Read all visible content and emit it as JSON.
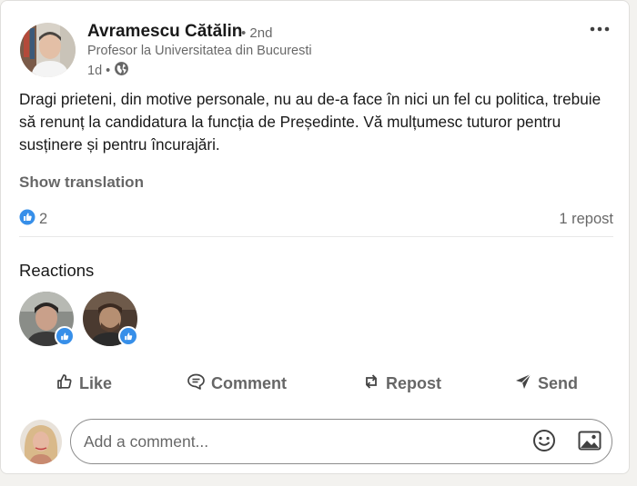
{
  "post": {
    "author": {
      "name": "Avramescu Cătălin",
      "degree": "• 2nd",
      "headline": "Profesor la Universitatea din Bucuresti",
      "time": "1d •",
      "visibility_icon": "globe-icon"
    },
    "more_icon": "more-horizontal-icon",
    "text": "Dragi prieteni, din motive personale, nu au de-a face în nici un fel cu politica, trebuie să renunț la candidatura la funcția de Președinte. Vă mulțumesc tuturor pentru susținere și pentru încurajări.",
    "show_translation": "Show translation",
    "reaction_count": "2",
    "repost_count": "1 repost"
  },
  "reactions": {
    "title": "Reactions",
    "reaction_icon": "like-icon"
  },
  "actions": {
    "like": "Like",
    "comment": "Comment",
    "repost": "Repost",
    "send": "Send"
  },
  "comment": {
    "placeholder": "Add a comment...",
    "emoji_icon": "emoji-icon",
    "image_icon": "image-icon"
  },
  "colors": {
    "like_blue": "#378fe9",
    "text_primary": "#191919",
    "text_secondary": "#666666",
    "background": "#f3f2ef"
  }
}
